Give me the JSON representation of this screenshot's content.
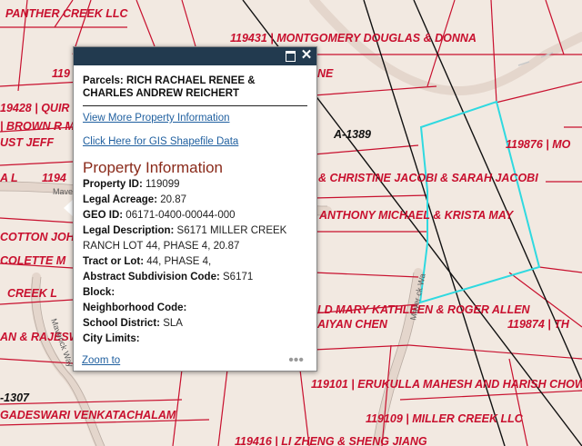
{
  "map": {
    "parcel_labels": [
      "PANTHER CREEK LLC",
      "119431 | MONTGOMERY DOUGLAS & DONNA",
      "119",
      "NE",
      "19428 | QUIR",
      "| BROWN R M",
      "UST JEFF",
      "119876 | MO",
      "A L",
      "1194",
      "& CHRISTINE JACOBI & SARAH JACOBI",
      "ANTHONY MICHAEL & KRISTA MAY",
      "COTTON JOHN",
      "COLETTE M",
      "CREEK L",
      "LD MARY KATHLEEN & ROGER ALLEN",
      "119874 | TH",
      "AIYAN CHEN",
      "AN & RAJESWA",
      "119101 | ERUKULLA MAHESH AND HARISH CHOW",
      "-1307",
      "GADESWARI VENKATACHALAM",
      "119109 | MILLER CREEK LLC",
      "119416 | LI ZHENG & SHENG JIANG"
    ],
    "abstract_label": "A-1389",
    "road_labels": [
      "Maver",
      "Maverick Way",
      "Maver ck Wa"
    ],
    "colors": {
      "parcel_line": "#c8102e",
      "selected_outline": "#2fd9e0",
      "background": "#f2e9e1"
    }
  },
  "popup": {
    "title": "Parcels: RICH RACHAEL RENEE & CHARLES ANDREW REICHERT",
    "link_more": "View More Property Information",
    "link_gis": "Click Here for GIS Shapefile Data",
    "heading": "Property Information",
    "fields": [
      {
        "label": "Property ID:",
        "value": "119099"
      },
      {
        "label": "Legal Acreage:",
        "value": "20.87"
      },
      {
        "label": "GEO ID:",
        "value": "06171-0400-00044-000"
      },
      {
        "label": "Legal Description:",
        "value": "S6171 MILLER CREEK RANCH LOT 44, PHASE 4, 20.87"
      },
      {
        "label": "Tract or Lot:",
        "value": "44, PHASE 4,"
      },
      {
        "label": "Abstract Subdivision Code:",
        "value": "S6171"
      },
      {
        "label": "Block:",
        "value": ""
      },
      {
        "label": "Neighborhood Code:",
        "value": ""
      },
      {
        "label": "School District:",
        "value": "SLA"
      },
      {
        "label": "City Limits:",
        "value": ""
      }
    ],
    "zoom_label": "Zoom to",
    "more_label": "•••",
    "header_icons": [
      "maximize-icon",
      "close-icon"
    ],
    "header_color": "#223a4f"
  }
}
